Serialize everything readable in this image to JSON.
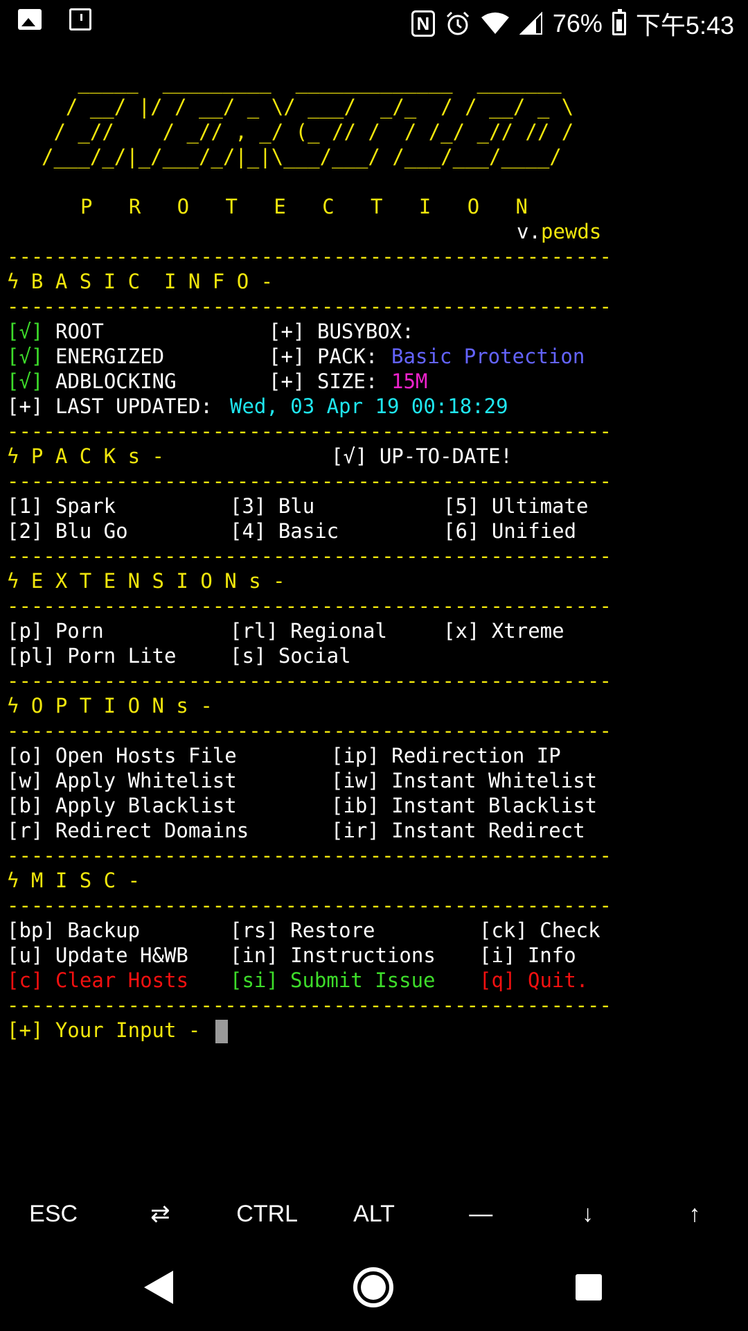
{
  "status_bar": {
    "battery": "76%",
    "time": "下午5:43",
    "nfc": "N"
  },
  "banner": {
    "ascii": [
      "   _____  _________  _____________  _______",
      "  / __/ |/ / __/ _ \\/ ___/  _/_  / / __/ _ \\",
      " / _//    / _// , _/ (_ // /  / /_/ _// // /",
      "/___/_/|_/___/_/|_|\\___/___/ /___/___/____/"
    ],
    "protection": "P   R   O   T   E   C   T   I   O   N",
    "version_prefix": "v.",
    "version": "pewds"
  },
  "divider": "--------------------------------------------------",
  "basic_info": {
    "header": "ϟ B A S I C  I N F O -",
    "check": "[√]",
    "root": "ROOT",
    "energized": "ENERGIZED",
    "adblocking": "ADBLOCKING",
    "plus": "[+]",
    "busybox": "BUSYBOX:",
    "pack_label": "PACK:",
    "pack_value": "Basic Protection",
    "size_label": "SIZE:",
    "size_value": "15M",
    "last_updated_label": "[+] LAST UPDATED:",
    "last_updated_value": "Wed, 03 Apr 19 00:18:29"
  },
  "packs": {
    "header": "ϟ P A C K s -",
    "status": "[√] UP-TO-DATE!",
    "items": [
      "[1] Spark",
      "[2] Blu Go",
      "[3] Blu",
      "[4] Basic",
      "[5] Ultimate",
      "[6] Unified"
    ]
  },
  "extensions": {
    "header": "ϟ E X T E N S I O N s -",
    "items": [
      "[p] Porn",
      "[pl] Porn Lite",
      "[rl] Regional",
      "[s] Social",
      "[x] Xtreme"
    ]
  },
  "options": {
    "header": "ϟ O P T I O N s -",
    "items": [
      "[o] Open Hosts File",
      "[w] Apply Whitelist",
      "[b] Apply Blacklist",
      "[r] Redirect Domains",
      "[ip] Redirection IP",
      "[iw] Instant Whitelist",
      "[ib] Instant Blacklist",
      "[ir] Instant Redirect"
    ]
  },
  "misc": {
    "header": "ϟ M I S C -",
    "items": [
      "[bp] Backup",
      "[u] Update H&WB",
      "[rs] Restore",
      "[in] Instructions",
      "[ck] Check",
      "[i] Info"
    ],
    "clear_key": "[c]",
    "clear_label": "Clear Hosts",
    "submit_key": "[si]",
    "submit_label": "Submit Issue",
    "quit_key": "[q]",
    "quit_label": "Quit."
  },
  "prompt": "[+] Your Input - ",
  "extra_keys": [
    "ESC",
    "⇄",
    "CTRL",
    "ALT",
    "—",
    "↓",
    "↑"
  ],
  "colors": {
    "yellow": "#f1e60c",
    "green": "#3ddc2a",
    "red": "#f21010",
    "cyan": "#1fe6ef",
    "blue": "#6464ff",
    "magenta": "#ee22cc"
  }
}
